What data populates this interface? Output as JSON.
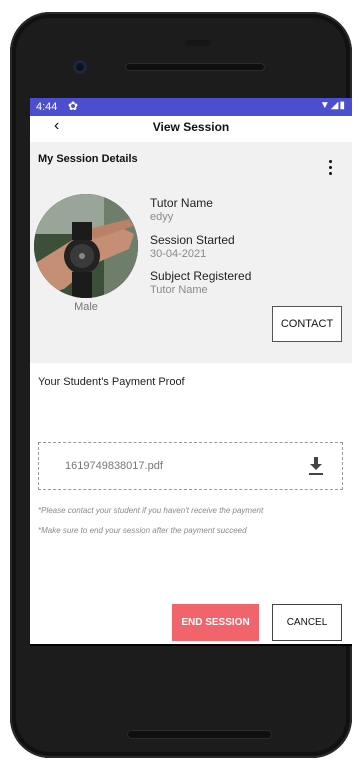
{
  "status_bar": {
    "time": "4:44",
    "settings_icon": "gear-icon"
  },
  "app_bar": {
    "back_icon": "back-chevron-icon",
    "title": "View Session"
  },
  "details": {
    "heading": "My Session Details",
    "gender": "Male",
    "tutor_name_label": "Tutor Name",
    "tutor_name_value": "edyy",
    "session_started_label": "Session Started",
    "session_started_value": "30-04-2021",
    "subject_label": "Subject Registered",
    "subject_value": "Tutor Name",
    "contact_label": "CONTACT"
  },
  "payment": {
    "title": "Your Student's Payment Proof",
    "file_name": "1619749838017.pdf",
    "note_1": "*Please contact your student if you haven't receive the payment",
    "note_2": "*Make sure to end your session after the payment succeed"
  },
  "actions": {
    "end_label": "END SESSION",
    "cancel_label": "CANCEL"
  },
  "colors": {
    "status_bar": "#4b4fcf",
    "end_button": "#f2646b"
  }
}
